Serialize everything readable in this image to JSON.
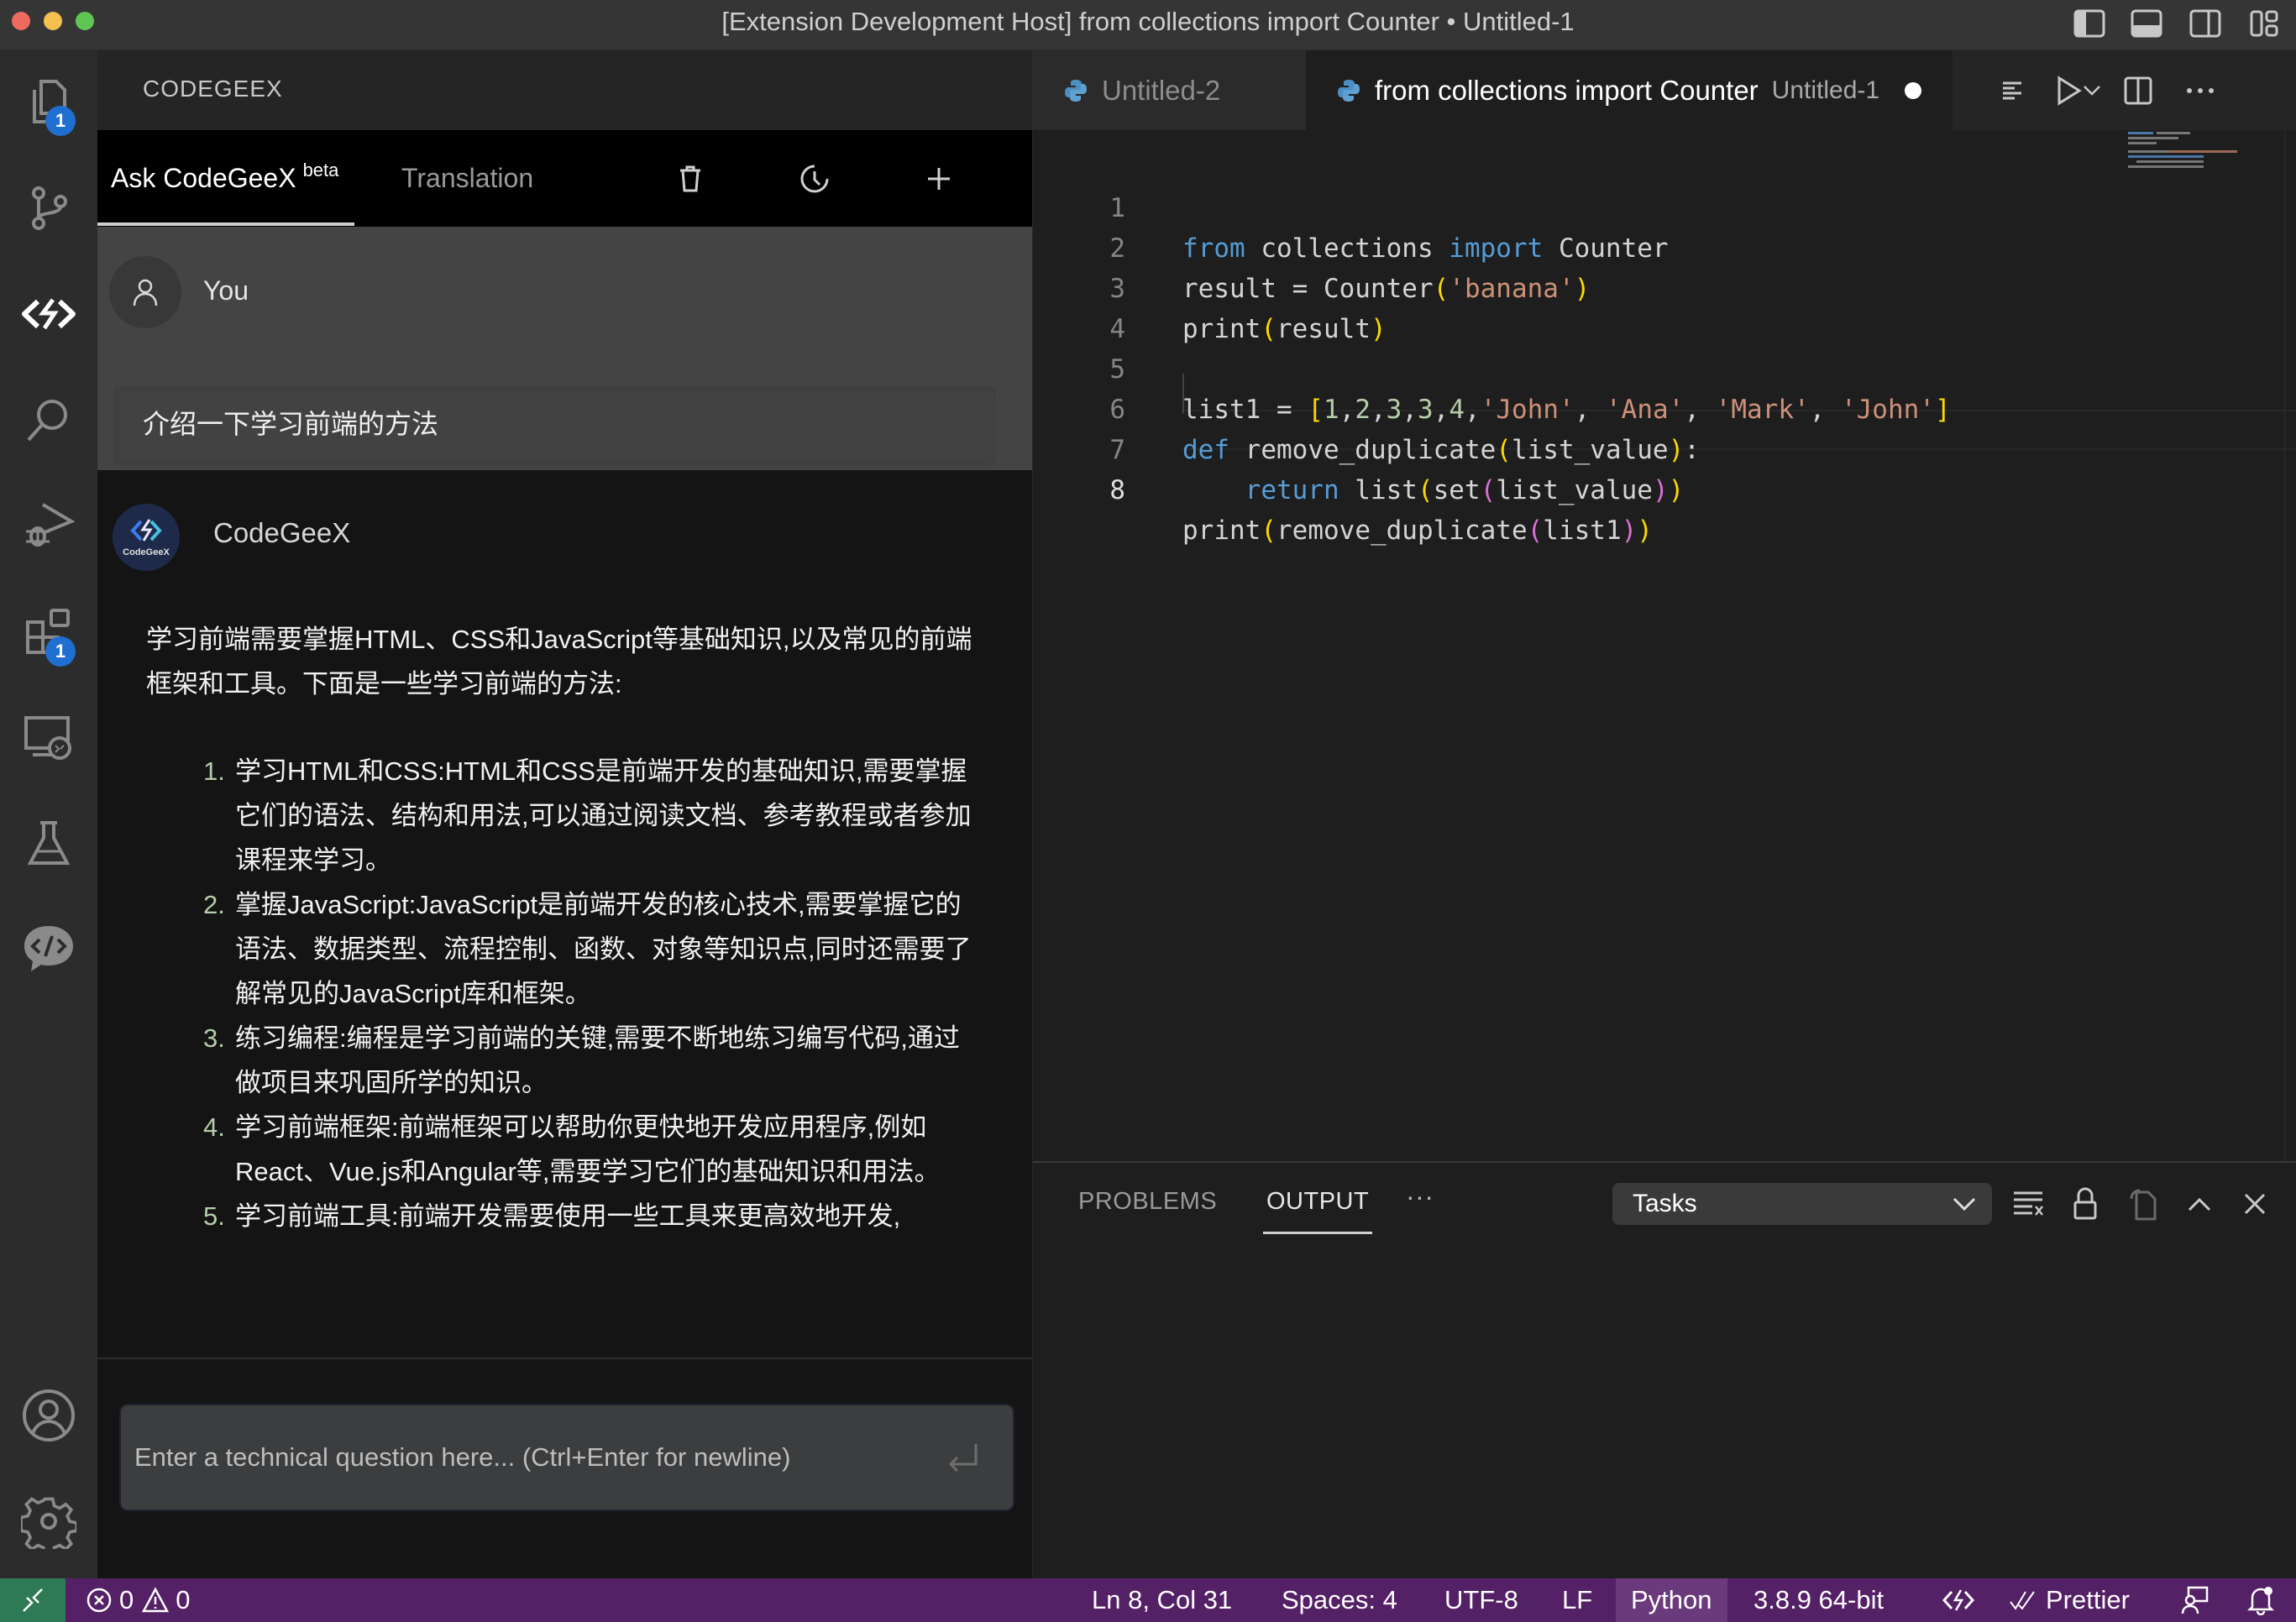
{
  "window": {
    "title": "[Extension Development Host] from collections import Counter • Untitled-1",
    "traffic_lights": {
      "close": "#ed6a5e",
      "minimize": "#f4bf4f",
      "maximize": "#61c554"
    },
    "layout_icons": [
      "toggle-primary-sidebar-icon",
      "toggle-panel-icon",
      "toggle-secondary-sidebar-icon",
      "customize-layout-icon"
    ]
  },
  "activity_bar": {
    "items": [
      {
        "name": "explorer",
        "icon": "files-icon",
        "badge": "1"
      },
      {
        "name": "source-control",
        "icon": "source-control-icon"
      },
      {
        "name": "codegeex",
        "icon": "codegeex-icon",
        "active": true
      },
      {
        "name": "search",
        "icon": "search-icon"
      },
      {
        "name": "run-debug",
        "icon": "run-debug-icon"
      },
      {
        "name": "extensions",
        "icon": "extensions-icon",
        "badge": "1"
      },
      {
        "name": "remote-explorer",
        "icon": "remote-explorer-icon"
      },
      {
        "name": "testing",
        "icon": "beaker-icon"
      },
      {
        "name": "codegeex-chat",
        "icon": "chat-code-icon"
      }
    ],
    "bottom": [
      {
        "name": "accounts",
        "icon": "account-icon"
      },
      {
        "name": "manage",
        "icon": "gear-icon"
      }
    ]
  },
  "sidebar": {
    "title": "CODEGEEX",
    "tabs": [
      {
        "label": "Ask CodeGeeX",
        "sup": "beta",
        "active": true
      },
      {
        "label": "Translation",
        "active": false
      }
    ],
    "actions": [
      "trash-icon",
      "history-icon",
      "plus-icon"
    ],
    "conversation": {
      "user": {
        "name": "You",
        "message": "介绍一下学习前端的方法"
      },
      "bot": {
        "name": "CodeGeeX",
        "avatar_label": "CodeGeeX",
        "intro": "学习前端需要掌握HTML、CSS和JavaScript等基础知识,以及常见的前端框架和工具。下面是一些学习前端的方法:",
        "items": [
          {
            "num": "1.",
            "text": "学习HTML和CSS:HTML和CSS是前端开发的基础知识,需要掌握它们的语法、结构和用法,可以通过阅读文档、参考教程或者参加课程来学习。"
          },
          {
            "num": "2.",
            "text": "掌握JavaScript:JavaScript是前端开发的核心技术,需要掌握它的语法、数据类型、流程控制、函数、对象等知识点,同时还需要了解常见的JavaScript库和框架。"
          },
          {
            "num": "3.",
            "text": "练习编程:编程是学习前端的关键,需要不断地练习编写代码,通过做项目来巩固所学的知识。"
          },
          {
            "num": "4.",
            "text": "学习前端框架:前端框架可以帮助你更快地开发应用程序,例如React、Vue.js和Angular等,需要学习它们的基础知识和用法。"
          },
          {
            "num": "5.",
            "text": "学习前端工具:前端开发需要使用一些工具来更高效地开发,"
          }
        ]
      }
    },
    "input": {
      "placeholder": "Enter a technical question here... (Ctrl+Enter for newline)",
      "value": ""
    }
  },
  "editor": {
    "tabs": [
      {
        "label": "Untitled-2",
        "icon": "python-icon",
        "active": false
      },
      {
        "label": "from collections import Counter",
        "sublabel": "Untitled-1",
        "icon": "python-icon",
        "active": true,
        "dirty": true
      }
    ],
    "actions": [
      "outline-icon",
      "run-icon",
      "run-dropdown-icon",
      "split-editor-icon",
      "more-actions-icon"
    ],
    "active_line": 8,
    "lines": [
      {
        "n": "1"
      },
      {
        "n": "2"
      },
      {
        "n": "3"
      },
      {
        "n": "4"
      },
      {
        "n": "5"
      },
      {
        "n": "6"
      },
      {
        "n": "7"
      },
      {
        "n": "8"
      }
    ],
    "code": {
      "l1": [
        "from",
        " collections ",
        "import",
        " Counter"
      ],
      "l2": [
        "result = Counter",
        "(",
        "'banana'",
        ")"
      ],
      "l3": [
        "print",
        "(",
        "result",
        ")"
      ],
      "l5": [
        "list1 = ",
        "[",
        "1",
        ",",
        "2",
        ",",
        "3",
        ",",
        "3",
        ",",
        "4",
        ",",
        "'John'",
        ", ",
        "'Ana'",
        ", ",
        "'Mark'",
        ", ",
        "'John'",
        "]"
      ],
      "l6": [
        "def",
        " remove_duplicate",
        "(",
        "list_value",
        ")",
        ":"
      ],
      "l7": [
        "    ",
        "return",
        " list",
        "(",
        "set",
        "(",
        "list_value",
        ")",
        ")"
      ],
      "l8": [
        "print",
        "(",
        "remove_duplicate",
        "(",
        "list1",
        ")",
        ")"
      ]
    }
  },
  "panel": {
    "tabs": [
      {
        "label": "PROBLEMS",
        "active": false
      },
      {
        "label": "OUTPUT",
        "active": true
      }
    ],
    "more": "···",
    "output_channel": "Tasks",
    "actions": [
      "clear-output-icon",
      "lock-scroll-icon",
      "open-output-editor-icon",
      "maximize-panel-icon",
      "close-panel-icon"
    ]
  },
  "status_bar": {
    "errors": "0",
    "warnings": "0",
    "cursor": "Ln 8, Col 31",
    "indent": "Spaces: 4",
    "encoding": "UTF-8",
    "eol": "LF",
    "language": "Python",
    "interpreter": "3.8.9 64-bit",
    "prettier": "Prettier",
    "colors": {
      "background": "#542066",
      "remote": "#2d7a55"
    }
  }
}
